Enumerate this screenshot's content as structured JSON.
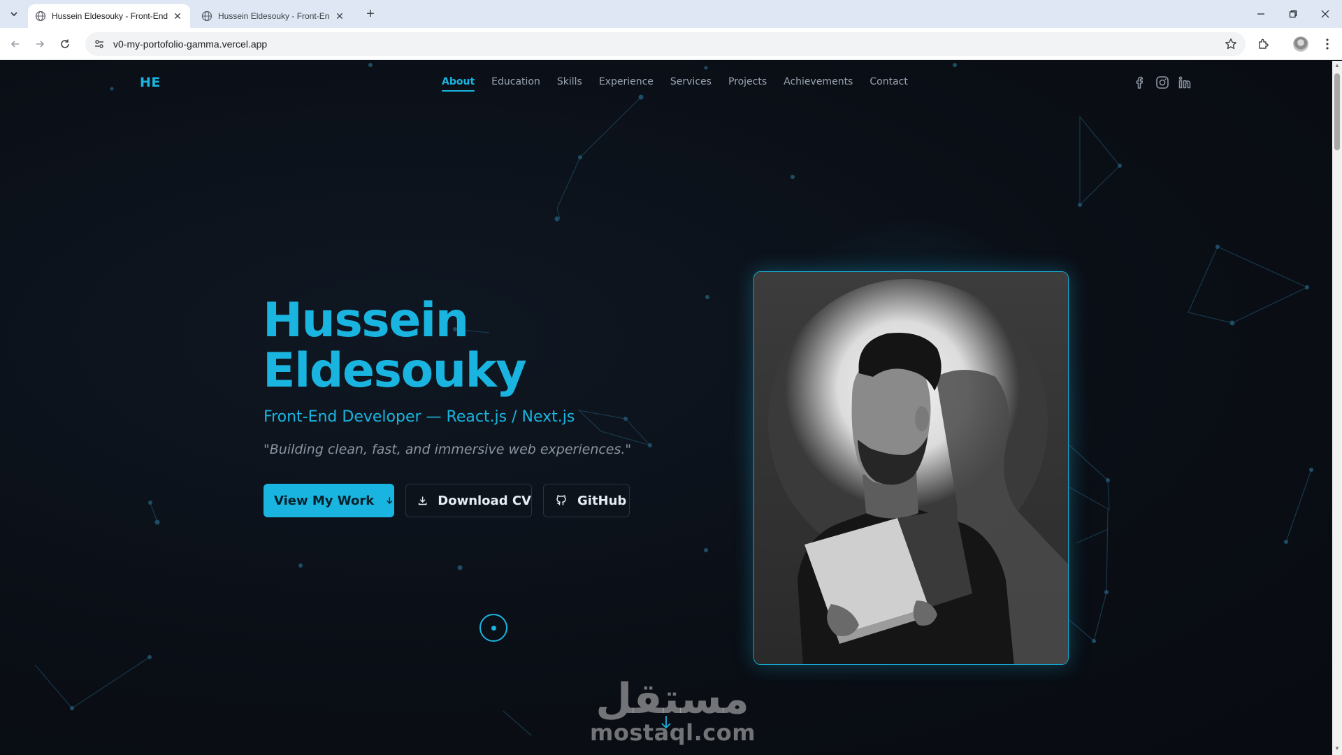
{
  "browser": {
    "tabs": [
      {
        "title": "Hussein Eldesouky - Front-End",
        "active": true
      },
      {
        "title": "Hussein Eldesouky - Front-End",
        "active": false
      }
    ],
    "url": "v0-my-portofolio-gamma.vercel.app"
  },
  "site": {
    "logo": "HE",
    "nav": [
      "About",
      "Education",
      "Skills",
      "Experience",
      "Services",
      "Projects",
      "Achievements",
      "Contact"
    ],
    "active_nav": "About",
    "socials": [
      "facebook-icon",
      "instagram-icon",
      "linkedin-icon"
    ]
  },
  "hero": {
    "name_line1": "Hussein",
    "name_line2": "Eldesouky",
    "subtitle": "Front-End Developer — React.js / Next.js",
    "quote": "\"Building clean, fast, and immersive web experiences.\"",
    "buttons": {
      "primary": "View My Work",
      "cv": "Download CV",
      "github": "GitHub"
    }
  },
  "watermark": {
    "arabic": "مستقل",
    "latin": "mostaql.com"
  },
  "colors": {
    "accent": "#19b5e0",
    "background": "#0b0f17",
    "muted_text": "#8b95a1"
  }
}
